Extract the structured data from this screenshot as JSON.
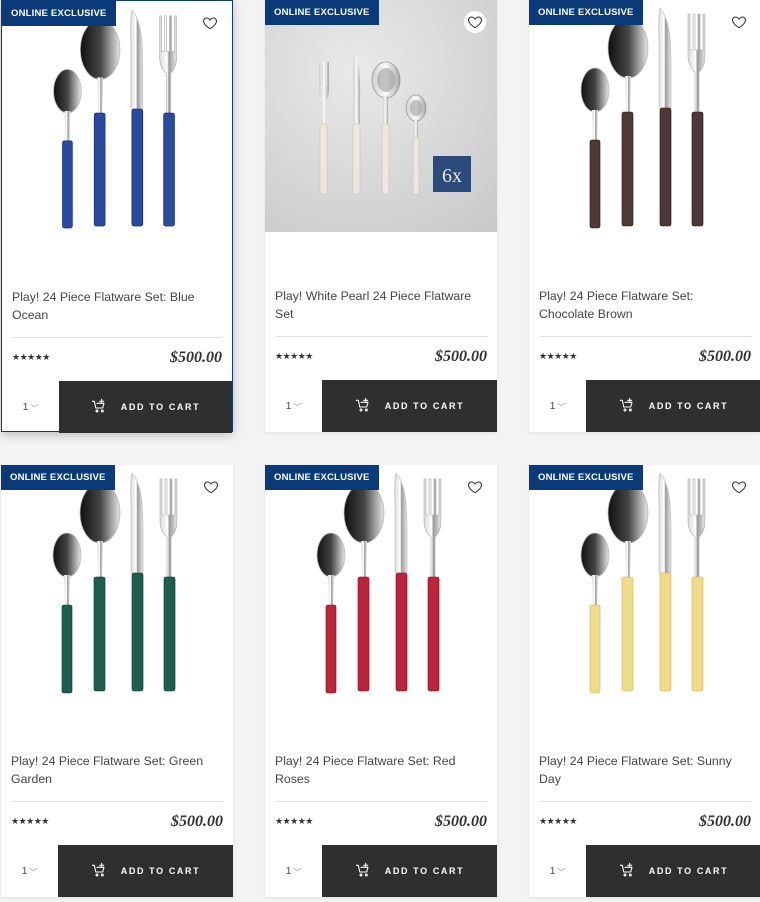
{
  "products": [
    {
      "badge": "ONLINE EXCLUSIVE",
      "title": "Play! 24 Piece Flatware Set: Blue Ocean",
      "stars": "★★★★★",
      "price": "$500.00",
      "qty": "1",
      "cta": "ADD TO CART",
      "handle_color": "#2a4a9c"
    },
    {
      "badge": "ONLINE EXCLUSIVE",
      "title": "Play! White Pearl 24 Piece Flatware Set",
      "stars": "★★★★★",
      "price": "$500.00",
      "qty": "1",
      "cta": "ADD TO CART",
      "handle_color": "#ece8df",
      "box_label": "6x"
    },
    {
      "badge": "ONLINE EXCLUSIVE",
      "title": "Play! 24 Piece Flatware Set: Chocolate Brown",
      "stars": "★★★★★",
      "price": "$500.00",
      "qty": "1",
      "cta": "ADD TO CART",
      "handle_color": "#4e3a34"
    },
    {
      "badge": "ONLINE EXCLUSIVE",
      "title": "Play! 24 Piece Flatware Set: Green Garden",
      "stars": "★★★★★",
      "price": "$500.00",
      "qty": "1",
      "cta": "ADD TO CART",
      "handle_color": "#1f5e4e"
    },
    {
      "badge": "ONLINE EXCLUSIVE",
      "title": "Play! 24 Piece Flatware Set: Red Roses",
      "stars": "★★★★★",
      "price": "$500.00",
      "qty": "1",
      "cta": "ADD TO CART",
      "handle_color": "#b7263a"
    },
    {
      "badge": "ONLINE EXCLUSIVE",
      "title": "Play! 24 Piece Flatware Set: Sunny Day",
      "stars": "★★★★★",
      "price": "$500.00",
      "qty": "1",
      "cta": "ADD TO CART",
      "handle_color": "#eedc8a"
    }
  ],
  "colors": {
    "badge_bg": "#0a3a78",
    "cta_bg": "#2f2f2f",
    "selected_border": "#0a3a78"
  },
  "icons": {
    "wishlist": "heart-outline-icon",
    "cart": "cart-add-icon",
    "qty": "chevron-down-icon"
  }
}
